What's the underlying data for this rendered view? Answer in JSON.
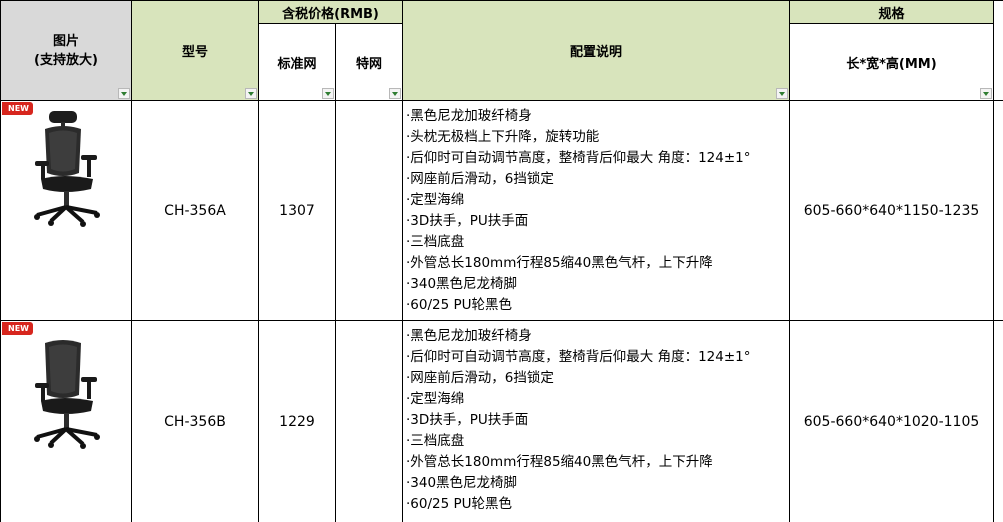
{
  "headers": {
    "image": "图片\n(支持放大)",
    "model": "型号",
    "price_group": "含税价格(RMB)",
    "price_standard": "标准网",
    "price_special": "特网",
    "config": "配置说明",
    "spec_group": "规格",
    "spec_dims": "长*宽*高(MM)"
  },
  "badge_text": "NEW",
  "rows": [
    {
      "model": "CH-356A",
      "price_standard": "1307",
      "price_special": "",
      "config": [
        "·黑色尼龙加玻纤椅身",
        "·头枕无极档上下升降，旋转功能",
        "·后仰时可自动调节高度，整椅背后仰最大 角度：124±1°",
        "·网座前后滑动，6挡锁定",
        "·定型海绵",
        "·3D扶手，PU扶手面",
        "·三档底盘",
        "·外管总长180mm行程85缩40黑色气杆，上下升降",
        "·340黑色尼龙椅脚",
        "·60/25 PU轮黑色"
      ],
      "dimensions": "605-660*640*1150-1235"
    },
    {
      "model": "CH-356B",
      "price_standard": "1229",
      "price_special": "",
      "config": [
        "·黑色尼龙加玻纤椅身",
        "·后仰时可自动调节高度，整椅背后仰最大 角度：124±1°",
        "·网座前后滑动，6挡锁定",
        "·定型海绵",
        "·3D扶手，PU扶手面",
        "·三档底盘",
        "·外管总长180mm行程85缩40黑色气杆，上下升降",
        "·340黑色尼龙椅脚",
        "·60/25 PU轮黑色"
      ],
      "dimensions": "605-660*640*1020-1105"
    }
  ],
  "colors": {
    "header_green": "#d8e4bc",
    "header_gray": "#d9d9d9",
    "badge_red": "#d7261e",
    "filter_arrow": "#2f7d32"
  },
  "icons": {
    "filter": "filter-dropdown-icon",
    "chair": "office-chair-image"
  }
}
